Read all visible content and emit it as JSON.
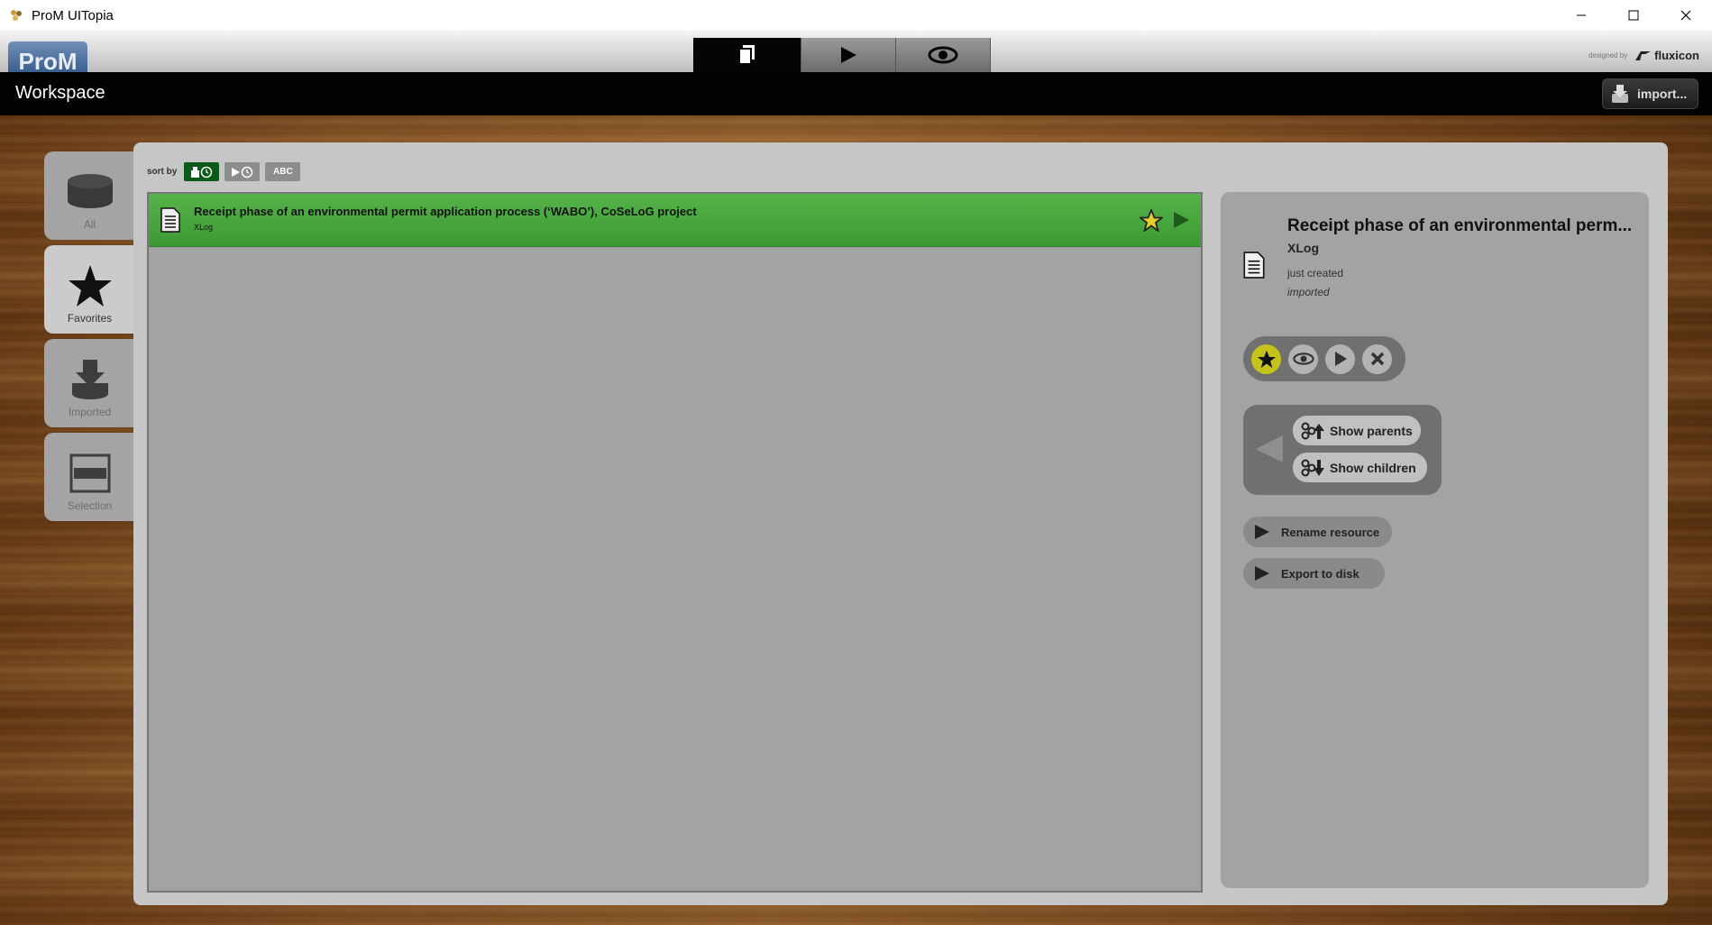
{
  "window": {
    "title": "ProM UITopia"
  },
  "header": {
    "logo": "ProM",
    "designed_by": "designed by",
    "brand": "fluxicon",
    "tabs": [
      {
        "name": "workspace-tab",
        "icon": "documents-icon",
        "active": true
      },
      {
        "name": "actions-tab",
        "icon": "play-icon",
        "active": false
      },
      {
        "name": "views-tab",
        "icon": "eye-icon",
        "active": false
      }
    ]
  },
  "workspace_bar": {
    "title": "Workspace",
    "import_label": "import..."
  },
  "sidebar": {
    "items": [
      {
        "label": "All",
        "icon": "database-icon",
        "active": false
      },
      {
        "label": "Favorites",
        "icon": "star-icon",
        "active": true
      },
      {
        "label": "Imported",
        "icon": "import-icon",
        "active": false
      },
      {
        "label": "Selection",
        "icon": "selection-icon",
        "active": false
      }
    ]
  },
  "sort": {
    "label": "sort by",
    "options": [
      {
        "name": "sort-by-created",
        "icon": "creation-clock-icon",
        "active": true
      },
      {
        "name": "sort-by-used",
        "icon": "play-clock-icon",
        "active": false
      },
      {
        "name": "sort-by-name",
        "text": "ABC",
        "active": false
      }
    ]
  },
  "resources": [
    {
      "name": "Receipt phase of an environmental permit application process (‘WABO’), CoSeLoG project",
      "type": "XLog",
      "favorite": true
    }
  ],
  "detail": {
    "title": "Receipt phase of an environmental perm...",
    "type": "XLog",
    "created": "just created",
    "source": "imported",
    "relations": {
      "parents_label": "Show parents",
      "children_label": "Show children"
    },
    "commands": {
      "rename_label": "Rename resource",
      "export_label": "Export to disk"
    }
  },
  "colors": {
    "selected_item": "#4aa83f",
    "favorite": "#c5c21b",
    "sort_active": "#0a5a1a"
  }
}
